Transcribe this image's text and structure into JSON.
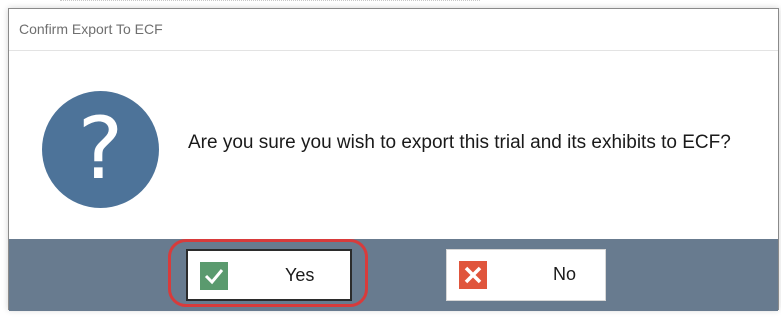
{
  "dialog": {
    "title": "Confirm Export To ECF",
    "message": "Are you sure you wish to export this trial and its exhibits to ECF?",
    "icon": "question-icon",
    "icon_glyph": "?",
    "icon_color": "#4d7399"
  },
  "buttons": {
    "yes": {
      "label": "Yes",
      "icon": "check-icon",
      "icon_color": "#5a9a6e"
    },
    "no": {
      "label": "No",
      "icon": "close-icon",
      "icon_color": "#e0553c"
    }
  },
  "colors": {
    "footer": "#687b8f",
    "highlight": "#d83b3b"
  }
}
